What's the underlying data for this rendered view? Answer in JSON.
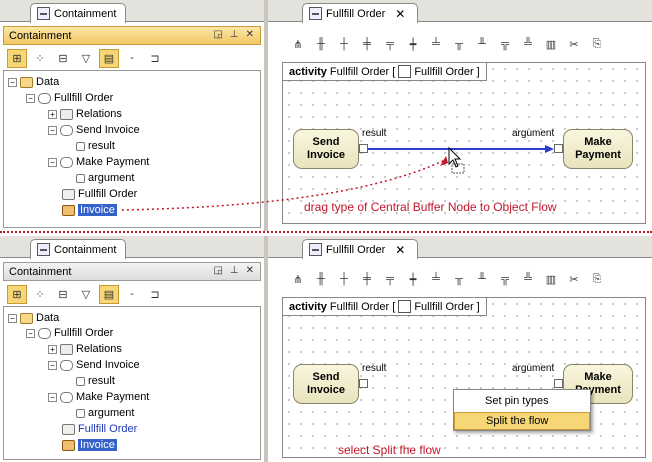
{
  "top": {
    "left_tab": "Containment",
    "pane_title": "Containment",
    "diagram_tab": "Fullfill Order",
    "frame": {
      "kind": "activity",
      "name": "Fullfill Order [",
      "ref": "Fullfill Order ]"
    },
    "tree": [
      {
        "label": "Data"
      },
      {
        "label": "Fullfill Order"
      },
      {
        "label": "Relations"
      },
      {
        "label": "Send Invoice"
      },
      {
        "label": "result"
      },
      {
        "label": "Make Payment"
      },
      {
        "label": "argument"
      },
      {
        "label": "Fullfill Order"
      },
      {
        "label": "Invoice"
      }
    ],
    "send_node": "Send Invoice",
    "make_node": "Make Payment",
    "pin_result": "result",
    "pin_argument": "argument",
    "annotation": "drag type of Central Buffer Node to Object Flow"
  },
  "bottom": {
    "left_tab": "Containment",
    "pane_title": "Containment",
    "diagram_tab": "Fullfill Order",
    "frame": {
      "kind": "activity",
      "name": "Fullfill Order [",
      "ref": "Fullfill Order ]"
    },
    "tree": [
      {
        "label": "Data"
      },
      {
        "label": "Fullfill Order"
      },
      {
        "label": "Relations"
      },
      {
        "label": "Send Invoice"
      },
      {
        "label": "result"
      },
      {
        "label": "Make Payment"
      },
      {
        "label": "argument"
      },
      {
        "label": "Fullfill Order"
      },
      {
        "label": "Invoice"
      }
    ],
    "send_node": "Send Invoice",
    "make_node": "Make Payment",
    "pin_result": "result",
    "pin_argument": "argument",
    "menu": [
      "Set pin types",
      "Split the flow"
    ],
    "annotation": "select Split fhe flow"
  },
  "colors": {
    "accent": "#f7d775",
    "selection": "#3462c8",
    "annotation": "#c0162a",
    "flow": "#2a3dcc"
  }
}
